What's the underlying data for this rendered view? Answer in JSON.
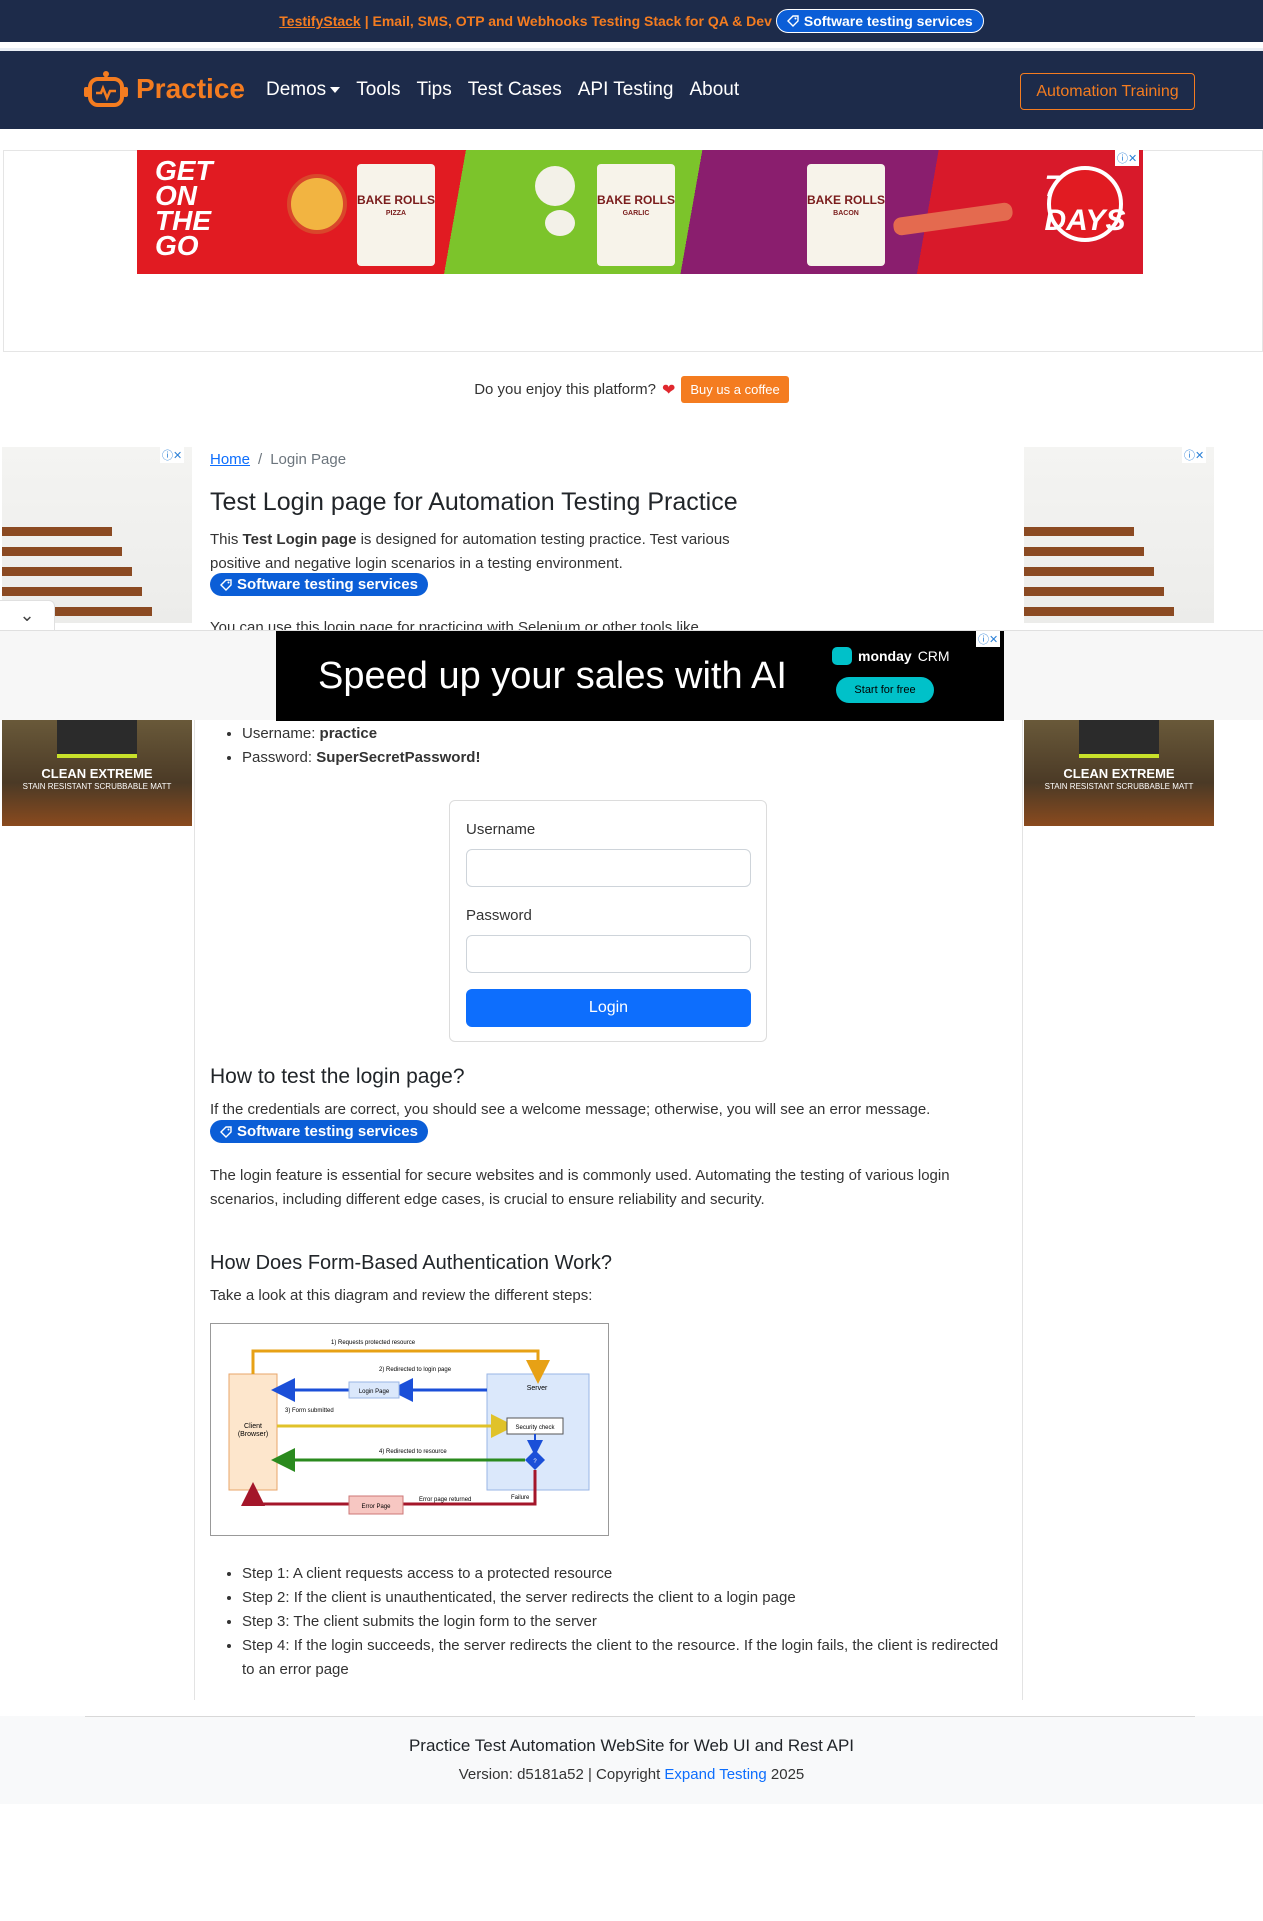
{
  "promo": {
    "link": "TestifyStack",
    "text": "| Email, SMS, OTP and Webhooks Testing Stack for QA & Dev",
    "badge": "Software testing services"
  },
  "nav": {
    "brand": "Practice",
    "items": [
      "Demos",
      "Tools",
      "Tips",
      "Test Cases",
      "API Testing",
      "About"
    ],
    "training": "Automation Training"
  },
  "top_ad": {
    "headline_lines": [
      "GET",
      "ON",
      "THE",
      "GO"
    ],
    "bags": [
      {
        "title": "BAKE ROLLS",
        "flavor": "PIZZA"
      },
      {
        "title": "BAKE ROLLS",
        "flavor": "GARLIC"
      },
      {
        "title": "BAKE ROLLS",
        "flavor": "BACON"
      }
    ],
    "brand_badge": "7 DAYS",
    "brand_mark": "7days"
  },
  "coffee": {
    "question": "Do you enjoy this platform?",
    "button": "Buy us a coffee"
  },
  "side_ad": {
    "title": "CLEAN EXTREME",
    "subtitle": "STAIN RESISTANT SCRUBBABLE MATT",
    "tag": "MATT"
  },
  "breadcrumb": {
    "home": "Home",
    "separator": "/",
    "current": "Login Page"
  },
  "page_title": "Test Login page for Automation Testing Practice",
  "intro": {
    "prefix": "This ",
    "bold": "Test Login page",
    "suffix": " is designed for automation testing practice. Test various positive and negative login scenarios in a testing environment."
  },
  "badge_label": "Software testing services",
  "partial_line": "You can use this login page for practicing with Selenium or other tools like",
  "sticky_ad": {
    "headline": "Speed up your sales with AI",
    "brand": "monday",
    "brand_suffix": "CRM",
    "cta": "Start for free"
  },
  "credentials": [
    {
      "label": "Username: ",
      "value": "practice"
    },
    {
      "label": "Password: ",
      "value": "SuperSecretPassword!"
    }
  ],
  "login_form": {
    "username_label": "Username",
    "password_label": "Password",
    "button": "Login"
  },
  "how_to": {
    "heading": "How to test the login page?",
    "text": "If the credentials are correct, you should see a welcome message; otherwise, you will see an error message.",
    "para": "The login feature is essential for secure websites and is commonly used. Automating the testing of various login scenarios, including different edge cases, is crucial to ensure reliability and security."
  },
  "form_auth": {
    "heading": "How Does Form-Based Authentication Work?",
    "text": "Take a look at this diagram and review the different steps:"
  },
  "diagram": {
    "labels": {
      "request": "1) Requests protected resource",
      "redirect_login": "2) Redirected to login page",
      "login_page": "Login Page",
      "server": "Server",
      "form_submitted": "3) Form submitted",
      "client": "Client",
      "browser": "(Browser)",
      "security_check": "Security check",
      "redirect_resource": "4) Redirected to resource",
      "decision": "?",
      "failure": "Failure",
      "error_returned": "Error page returned",
      "error_page": "Error Page"
    }
  },
  "steps": [
    "Step 1: A client requests access to a protected resource",
    "Step 2: If the client is unauthenticated, the server redirects the client to a login page",
    "Step 3: The client submits the login form to the server",
    "Step 4: If the login succeeds, the server redirects the client to the resource. If the login fails, the client is redirected to an error page"
  ],
  "footer": {
    "title": "Practice Test Automation WebSite for Web UI and Rest API",
    "version_prefix": "Version: d5181a52 | Copyright ",
    "company": "Expand Testing",
    "year": " 2025"
  },
  "colors": {
    "navy": "#1d2b4a",
    "orange": "#f47c20",
    "primary": "#0d6efd"
  }
}
